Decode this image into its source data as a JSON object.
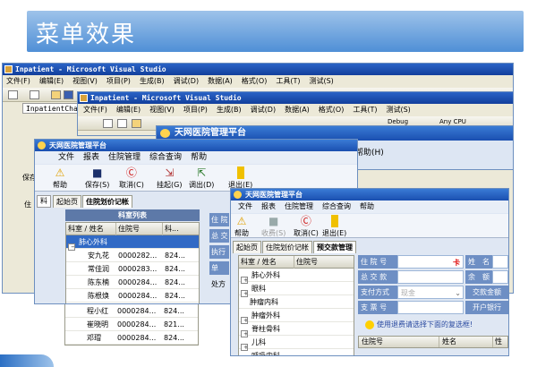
{
  "slide": {
    "title": "菜单效果"
  },
  "vs1": {
    "title": "Inpatient - Microsoft Visual Studio",
    "menu": [
      "文件(F)",
      "编辑(E)",
      "视图(V)",
      "项目(P)",
      "生成(B)",
      "调试(D)",
      "数据(A)",
      "格式(O)",
      "工具(T)",
      "测试(S)"
    ],
    "tab": "InpatientChar",
    "side_labels": [
      "住",
      "保存"
    ]
  },
  "vs2": {
    "title": "Inpatient - Microsoft Visual Studio",
    "menu": [
      "文件(F)",
      "编辑(E)",
      "视图(V)",
      "项目(P)",
      "生成(B)",
      "调试(D)",
      "数据(A)",
      "格式(O)",
      "工具(T)",
      "测试(S)"
    ],
    "toolbar_right": "Debug",
    "toolbar_right2": "Any CPU"
  },
  "app_mid": {
    "title": "天网医院管理平台",
    "menu_right": "帮助(H)"
  },
  "app1": {
    "title": "天网医院管理平台",
    "menu": [
      "文件",
      "报表",
      "住院管理",
      "综合查询",
      "帮助"
    ],
    "buttons": [
      "帮助",
      "保存(S)",
      "取消(C)",
      "挂起(G)",
      "调出(D)",
      "退出(E)"
    ],
    "tabs": [
      "起始页",
      "住院划价记帐"
    ],
    "left_tab": "料",
    "panel_title": "科室列表",
    "columns": [
      "科室 / 姓名",
      "住院号",
      "科..."
    ],
    "rows": [
      {
        "name": "肺心外科",
        "id": "",
        "dept": ""
      },
      {
        "name": "安九花",
        "id": "0000282...",
        "dept": "824..."
      },
      {
        "name": "常佳润",
        "id": "0000283...",
        "dept": "824..."
      },
      {
        "name": "陈东楠",
        "id": "0000284...",
        "dept": "824..."
      },
      {
        "name": "陈根焕",
        "id": "0000284...",
        "dept": "824..."
      },
      {
        "name": "程小红",
        "id": "0000284...",
        "dept": "824..."
      },
      {
        "name": "崔晓明",
        "id": "0000284...",
        "dept": "821..."
      },
      {
        "name": "邓瑁",
        "id": "0000284...",
        "dept": "824..."
      }
    ],
    "right_labels": [
      "住 院",
      "总 交",
      "执行",
      "单",
      "处方"
    ]
  },
  "app2": {
    "title": "天网医院管理平台",
    "menu": [
      "文件",
      "报表",
      "住院管理",
      "综合查询",
      "帮助"
    ],
    "buttons": [
      "帮助",
      "收费(S)",
      "取消(C)",
      "退出(E)"
    ],
    "tabs": [
      "起始页",
      "住院划价记帐",
      "预交款管理"
    ],
    "columns": [
      "科室 / 姓名",
      "住院号"
    ],
    "rows": [
      "肺心外科",
      "眼科",
      "肿瘤内科",
      "肿瘤外科",
      "脊柱骨科",
      "儿科",
      "呼吸内科"
    ],
    "form": {
      "inpatient_no": "住 院 号",
      "card_btn": "卡",
      "name": "姓　名",
      "deposit": "总 交 款",
      "balance": "余　额",
      "pay_method": "支付方式",
      "pay_method_value": "现金",
      "deposit_amount": "交款金额",
      "cheque_no": "支 票 号",
      "bank": "开户银行"
    },
    "hint": "使用退费请选择下面的复选框!",
    "bottom_columns": [
      "住院号",
      "姓名",
      "性"
    ]
  }
}
